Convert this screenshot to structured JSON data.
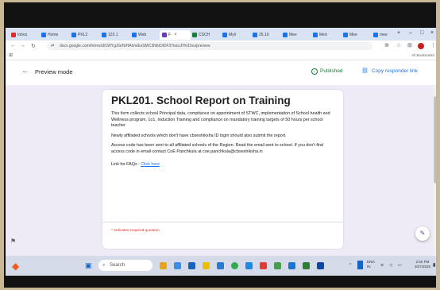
{
  "browser": {
    "tabs": [
      {
        "label": "Inbox",
        "color": "#d93025"
      },
      {
        "label": "Home",
        "color": "#1a73e8"
      },
      {
        "label": "PKL2",
        "color": "#1a73e8"
      },
      {
        "label": "123.1",
        "color": "#1a73e8"
      },
      {
        "label": "Web",
        "color": "#1a73e8"
      },
      {
        "label": "F",
        "color": "#673ab7",
        "active": true
      },
      {
        "label": "CSCH",
        "color": "#188038"
      },
      {
        "label": "Myli",
        "color": "#1a73e8"
      },
      {
        "label": "25.10",
        "color": "#1a73e8"
      },
      {
        "label": "Mee",
        "color": "#1a73e8"
      },
      {
        "label": "Mert",
        "color": "#1a73e8"
      },
      {
        "label": "Mee",
        "color": "#1a73e8"
      },
      {
        "label": "mee",
        "color": "#1a73e8"
      }
    ],
    "url": "docs.google.com/forms/d/1WYgJGrNiHAh/viEsSMC3NbIOiDF3TooLdYKiOvu/preview",
    "bookmarks_all": "All Bookmarks",
    "window_controls": {
      "minimize": "–",
      "maximize": "□",
      "close": "×"
    }
  },
  "forms_header": {
    "back_icon": "arrow-left-icon",
    "preview_label": "Preview mode",
    "published_label": "Published",
    "copy_link_label": "Copy responder link"
  },
  "form": {
    "title": "PKL201. School Report on Training",
    "paragraphs": [
      "This form collects school Principal data, compliance on appointment of STWC, implementation of School health and Wellness program, 1o1, Induction Training and compliance on mandatory training targets of 50 hours per school teacher",
      "Newly affiliated schools which don't have cbseshiksha ID login should also submit the report.",
      "Access code has been sent to all affiliated schools of the Region. Read the email sent to school. If you don't find  access code in email contact CoE Panchkula at coe.panchkula@cbseshiksha.in"
    ],
    "faq_label": "Link for FAQs :",
    "faq_link": "Click here",
    "required_note": "* Indicates required question"
  },
  "taskbar": {
    "search_placeholder": "Search",
    "tray_lang": "ENG",
    "tray_region": "IN",
    "clock_time": "2:50 PM",
    "clock_date": "3/27/2025"
  },
  "colors": {
    "forms_accent": "#673ab7",
    "published_green": "#188038",
    "link_blue": "#1a73e8",
    "required_red": "#d93025"
  }
}
